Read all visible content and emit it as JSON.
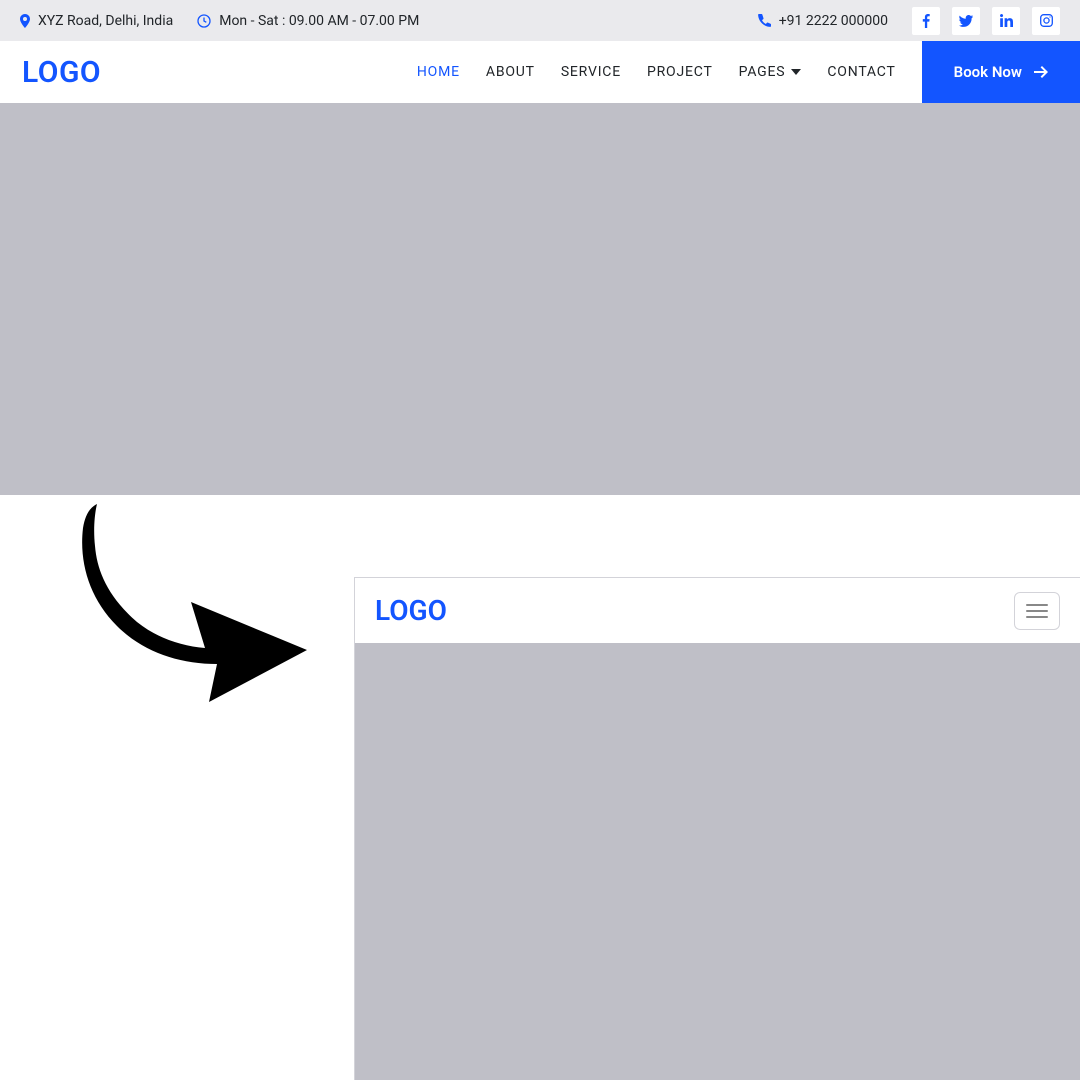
{
  "topbar": {
    "address": "XYZ Road, Delhi, India",
    "hours": "Mon - Sat : 09.00 AM - 07.00 PM",
    "phone": "+91 2222 000000"
  },
  "nav": {
    "logo": "LOGO",
    "links": {
      "home": "HOME",
      "about": "ABOUT",
      "service": "SERVICE",
      "project": "PROJECT",
      "pages": "PAGES",
      "contact": "CONTACT"
    },
    "book": "Book Now"
  },
  "mobile": {
    "logo": "LOGO"
  }
}
